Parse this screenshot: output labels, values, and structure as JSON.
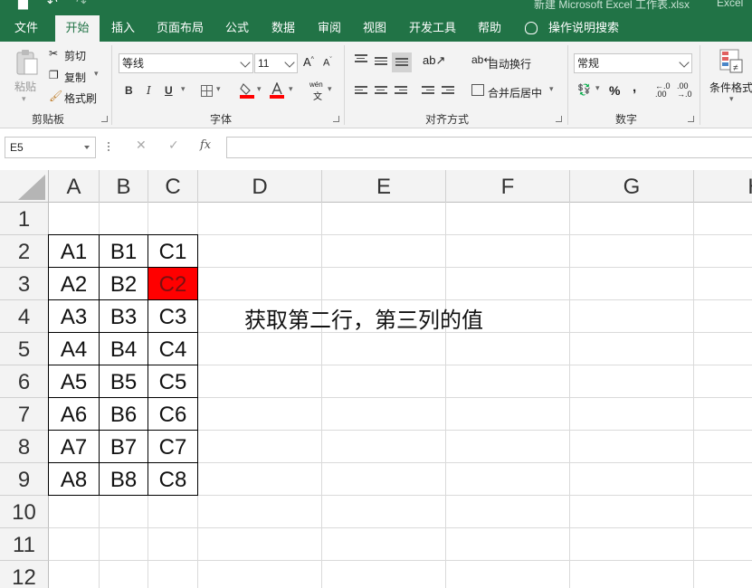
{
  "titlebar": {
    "doc_title": "新建 Microsoft Excel 工作表.xlsx",
    "app_name": "Excel",
    "bg_color": "#217346"
  },
  "tabs": [
    {
      "label": "文件",
      "active": false
    },
    {
      "label": "开始",
      "active": true
    },
    {
      "label": "插入",
      "active": false
    },
    {
      "label": "页面布局",
      "active": false
    },
    {
      "label": "公式",
      "active": false
    },
    {
      "label": "数据",
      "active": false
    },
    {
      "label": "审阅",
      "active": false
    },
    {
      "label": "视图",
      "active": false
    },
    {
      "label": "开发工具",
      "active": false
    },
    {
      "label": "帮助",
      "active": false
    }
  ],
  "tell_me": "操作说明搜索",
  "ribbon": {
    "clipboard": {
      "paste": "粘贴",
      "cut": "剪切",
      "copy": "复制",
      "format_painter": "格式刷",
      "label": "剪贴板"
    },
    "font": {
      "name": "等线",
      "size": "11",
      "bold": "B",
      "italic": "I",
      "underline": "U",
      "label": "字体",
      "pinyin": "wén"
    },
    "alignment": {
      "wrap_text": "自动换行",
      "merge_center": "合并后居中",
      "label": "对齐方式"
    },
    "number": {
      "format": "常规",
      "percent": "%",
      "comma": ",",
      "label": "数字"
    },
    "styles": {
      "conditional": "条件格式"
    }
  },
  "formula_bar": {
    "name_box": "E5",
    "fx": "fx",
    "content": ""
  },
  "columns": [
    "A",
    "B",
    "C",
    "D",
    "E",
    "F",
    "G",
    "H"
  ],
  "rows": [
    "1",
    "2",
    "3",
    "4",
    "5",
    "6",
    "7",
    "8",
    "9",
    "10",
    "11",
    "12"
  ],
  "table": [
    [
      "A1",
      "B1",
      "C1"
    ],
    [
      "A2",
      "B2",
      "C2"
    ],
    [
      "A3",
      "B3",
      "C3"
    ],
    [
      "A4",
      "B4",
      "C4"
    ],
    [
      "A5",
      "B5",
      "C5"
    ],
    [
      "A6",
      "B6",
      "C6"
    ],
    [
      "A7",
      "B7",
      "C7"
    ],
    [
      "A8",
      "B8",
      "C8"
    ]
  ],
  "highlight_cell": "C2",
  "highlight_color": "#ff0000",
  "note": "获取第二行，第三列的值"
}
